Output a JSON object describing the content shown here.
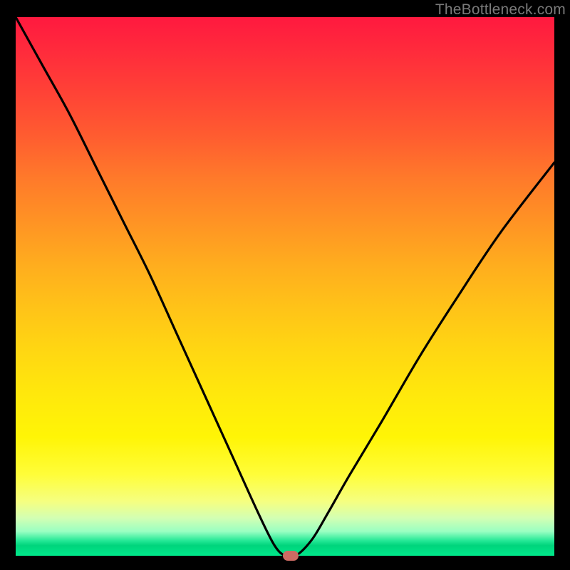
{
  "watermark": "TheBottleneck.com",
  "chart_data": {
    "type": "line",
    "title": "",
    "xlabel": "",
    "ylabel": "",
    "xlim": [
      0,
      100
    ],
    "ylim": [
      0,
      100
    ],
    "grid": false,
    "series": [
      {
        "name": "bottleneck-curve",
        "x": [
          0,
          5,
          10,
          15,
          20,
          25,
          30,
          35,
          40,
          45,
          48,
          50,
          52,
          55,
          58,
          62,
          68,
          75,
          82,
          90,
          100
        ],
        "values": [
          100,
          91,
          82,
          72,
          62,
          52,
          41,
          30,
          19,
          8,
          2,
          0,
          0,
          3,
          8,
          15,
          25,
          37,
          48,
          60,
          73
        ]
      }
    ],
    "background_gradient": {
      "top": "#ff193f",
      "mid": "#ffe80c",
      "bottom": "#00e88a"
    },
    "optimum_marker": {
      "x": 51,
      "y": 0,
      "color": "#cc6b63"
    }
  }
}
